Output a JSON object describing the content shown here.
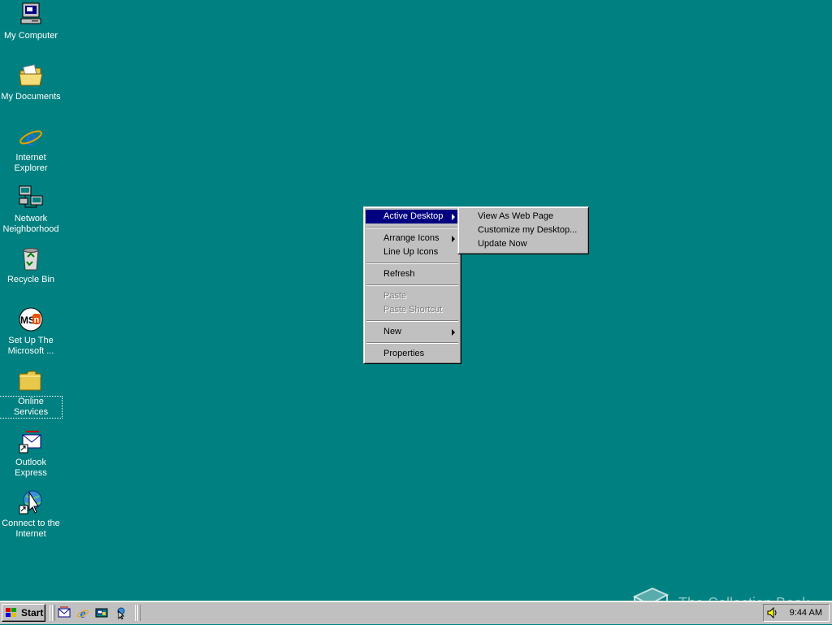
{
  "desktop": {
    "background": "#008080",
    "icons": [
      {
        "label": "My Computer",
        "icon": "computer-icon"
      },
      {
        "label": "My Documents",
        "icon": "documents-folder-icon"
      },
      {
        "label": "Internet Explorer",
        "icon": "internet-explorer-icon"
      },
      {
        "label": "Network Neighborhood",
        "icon": "network-icon"
      },
      {
        "label": "Recycle Bin",
        "icon": "recycle-bin-icon"
      },
      {
        "label": "Set Up The Microsoft ...",
        "icon": "msn-icon"
      },
      {
        "label": "Online Services",
        "icon": "folder-icon"
      },
      {
        "label": "Outlook Express",
        "icon": "outlook-express-icon"
      },
      {
        "label": "Connect to the Internet",
        "icon": "connect-wizard-icon"
      }
    ]
  },
  "context_menu": {
    "items": [
      {
        "label": "Active Desktop",
        "submenu": true,
        "selected": true
      },
      {
        "label": "Arrange Icons",
        "submenu": true
      },
      {
        "label": "Line Up Icons"
      },
      {
        "label": "Refresh"
      },
      {
        "label": "Paste",
        "disabled": true
      },
      {
        "label": "Paste Shortcut",
        "disabled": true
      },
      {
        "label": "New",
        "submenu": true
      },
      {
        "label": "Properties"
      }
    ]
  },
  "submenu": {
    "items": [
      {
        "label": "View As Web Page"
      },
      {
        "label": "Customize my Desktop..."
      },
      {
        "label": "Update Now"
      }
    ]
  },
  "taskbar": {
    "start_label": "Start",
    "quick_launch": [
      "outlook-express-icon",
      "internet-explorer-icon",
      "show-desktop-icon",
      "view-channels-icon"
    ],
    "clock": "9:44 AM",
    "tray_icon": "volume-icon"
  },
  "watermark": {
    "text": "The Collection Book",
    "icon": "book-icon"
  },
  "colors": {
    "highlight": "#000080",
    "face": "#c0c0c0",
    "desktop": "#008080"
  }
}
